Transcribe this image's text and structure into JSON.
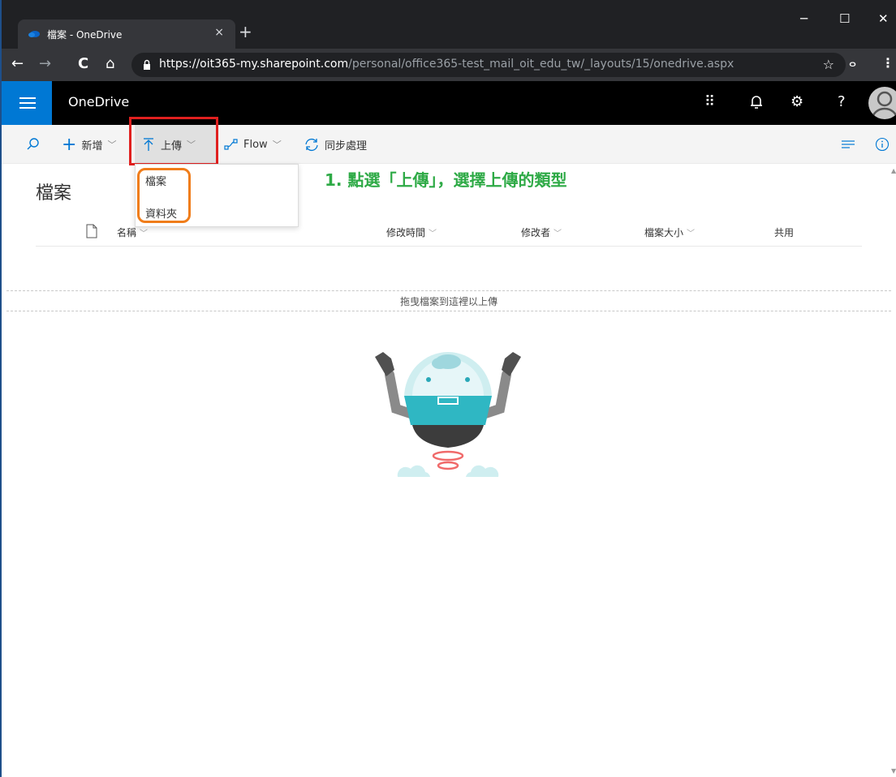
{
  "browser": {
    "tab_title": "檔案 - OneDrive",
    "tab_close": "×",
    "new_tab": "+",
    "url_host": "https://oit365-my.sharepoint.com",
    "url_path": "/personal/office365-test_mail_oit_edu_tw/_layouts/15/onedrive.aspx",
    "icons": {
      "back": "←",
      "forward": "→",
      "reload": "C",
      "home": "⌂",
      "star": "☆",
      "extension": "ⴰ",
      "menu": "⋮",
      "minimize": "─",
      "maximize": "☐",
      "close": "✕"
    }
  },
  "suite": {
    "app_name": "OneDrive",
    "icons": {
      "apps": "⠿",
      "bell": "🔔",
      "gear": "⚙",
      "help": "?"
    }
  },
  "commands": {
    "new_label": "新增",
    "upload_label": "上傳",
    "flow_label": "Flow",
    "sync_label": "同步處理"
  },
  "upload_menu": {
    "items": [
      "檔案",
      "資料夾"
    ]
  },
  "annotation": "1. 點選「上傳」，選擇上傳的類型",
  "page": {
    "title": "檔案",
    "columns": {
      "name": "名稱",
      "modified": "修改時間",
      "modified_by": "修改者",
      "size": "檔案大小",
      "sharing": "共用"
    },
    "dropzone_text": "拖曳檔案到這裡以上傳"
  },
  "colors": {
    "accent": "#0078d4",
    "highlight_red": "#e0201f",
    "highlight_orange": "#f07d1a",
    "annotation_green": "#2eaa46"
  }
}
